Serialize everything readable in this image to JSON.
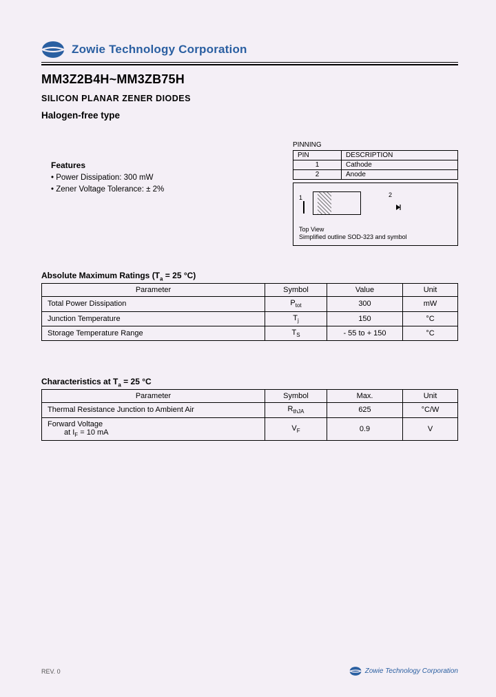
{
  "company": "Zowie Technology Corporation",
  "part_number": "MM3Z2B4H~MM3ZB75H",
  "subtitle1": "SILICON PLANAR ZENER DIODES",
  "subtitle2": "Halogen-free type",
  "features": {
    "heading": "Features",
    "items": [
      "Power Dissipation: 300 mW",
      "Zener Voltage Tolerance: ± 2%"
    ]
  },
  "pinning": {
    "title": "PINNING",
    "headers": [
      "PIN",
      "DESCRIPTION"
    ],
    "rows": [
      {
        "pin": "1",
        "desc": "Cathode"
      },
      {
        "pin": "2",
        "desc": "Anode"
      }
    ],
    "pkg_label1": "1",
    "pkg_label2": "2",
    "caption1": "Top View",
    "caption2": "Simplified outline SOD-323 and symbol"
  },
  "amr": {
    "heading_prefix": "Absolute Maximum Ratings (T",
    "heading_sub": "a",
    "heading_suffix": " = 25 °C)",
    "headers": [
      "Parameter",
      "Symbol",
      "Value",
      "Unit"
    ],
    "rows": [
      {
        "param": "Total Power Dissipation",
        "sym_pre": "P",
        "sym_sub": "tot",
        "sym_post": "",
        "value": "300",
        "unit": "mW"
      },
      {
        "param": "Junction Temperature",
        "sym_pre": "T",
        "sym_sub": "j",
        "sym_post": "",
        "value": "150",
        "unit": "°C"
      },
      {
        "param": "Storage Temperature Range",
        "sym_pre": "T",
        "sym_sub": "S",
        "sym_post": "",
        "value": "- 55 to + 150",
        "unit": "°C"
      }
    ]
  },
  "char": {
    "heading_prefix": "Characteristics at T",
    "heading_sub": "a",
    "heading_suffix": " = 25 °C",
    "headers": [
      "Parameter",
      "Symbol",
      "Max.",
      "Unit"
    ],
    "rows": [
      {
        "param": "Thermal Resistance Junction to Ambient Air",
        "param2_pre": "",
        "param2_sub": "",
        "param2_post": "",
        "sym_pre": "R",
        "sym_sub": "thJA",
        "value": "625",
        "unit": "°C/W"
      },
      {
        "param": "Forward Voltage",
        "param2_pre": "at I",
        "param2_sub": "F",
        "param2_post": " = 10 mA",
        "sym_pre": "V",
        "sym_sub": "F",
        "value": "0.9",
        "unit": "V"
      }
    ]
  },
  "footer": {
    "rev": "REV. 0",
    "company": "Zowie Technology Corporation"
  }
}
